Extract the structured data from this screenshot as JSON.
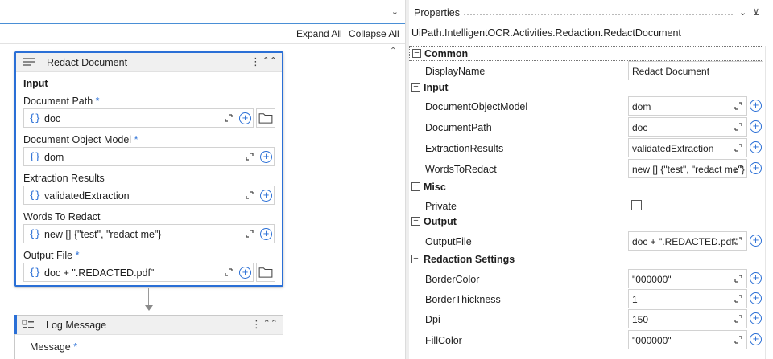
{
  "designer": {
    "expand_all": "Expand All",
    "collapse_all": "Collapse All",
    "redact_activity": {
      "title": "Redact Document",
      "section_input": "Input",
      "fields": [
        {
          "label": "Document Path",
          "required": "*",
          "value": "doc"
        },
        {
          "label": "Document Object Model",
          "required": "*",
          "value": "dom"
        },
        {
          "label": "Extraction Results",
          "required": "",
          "value": "validatedExtraction"
        },
        {
          "label": "Words To Redact",
          "required": "",
          "value": "new [] {\"test\", \"redact me\"}"
        },
        {
          "label": "Output File",
          "required": "*",
          "value": "doc + \".REDACTED.pdf\""
        }
      ],
      "brace": "{}"
    },
    "log_activity": {
      "title": "Log Message",
      "message_label": "Message",
      "message_required": "*"
    }
  },
  "properties": {
    "title": "Properties",
    "type_name": "UiPath.IntelligentOCR.Activities.Redaction.RedactDocument",
    "categories": {
      "common": "Common",
      "input": "Input",
      "misc": "Misc",
      "output": "Output",
      "redaction": "Redaction Settings"
    },
    "rows": {
      "display_name": {
        "name": "DisplayName",
        "value": "Redact Document"
      },
      "document_object_model": {
        "name": "DocumentObjectModel",
        "value": "dom"
      },
      "document_path": {
        "name": "DocumentPath",
        "value": "doc"
      },
      "extraction_results": {
        "name": "ExtractionResults",
        "value": "validatedExtraction"
      },
      "words_to_redact": {
        "name": "WordsToRedact",
        "value": "new [] {\"test\", \"redact me\"}"
      },
      "private": {
        "name": "Private",
        "checked": false
      },
      "output_file": {
        "name": "OutputFile",
        "value": "doc + \".REDACTED.pdf\""
      },
      "border_color": {
        "name": "BorderColor",
        "value": "\"000000\""
      },
      "border_thickness": {
        "name": "BorderThickness",
        "value": "1"
      },
      "dpi": {
        "name": "Dpi",
        "value": "150"
      },
      "fill_color": {
        "name": "FillColor",
        "value": "\"000000\""
      }
    },
    "toggle_symbol": "⊟"
  },
  "colors": {
    "accent": "#2a6fd6",
    "header_bg": "#f0f0f0",
    "border": "#d2d2d2"
  }
}
